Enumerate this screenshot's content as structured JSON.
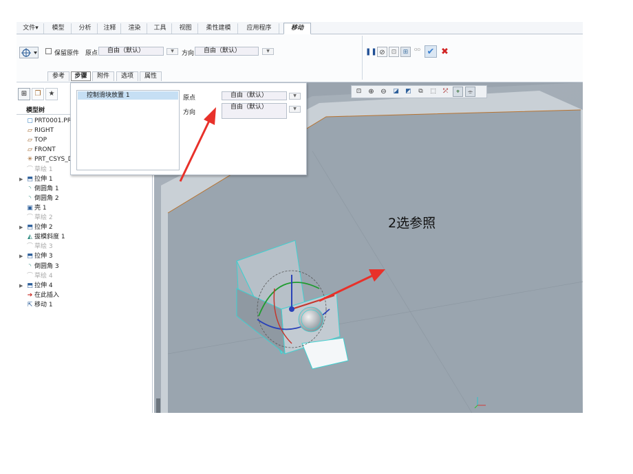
{
  "menu": {
    "tabs": [
      "文件▾",
      "模型",
      "分析",
      "注释",
      "渲染",
      "工具",
      "视图",
      "柔性建模",
      "应用程序",
      "移动"
    ]
  },
  "ribbon": {
    "keep_original_label": "保留原件",
    "origin_label": "原点",
    "origin_value": "自由（默认）",
    "direction_label": "方向",
    "direction_value": "自由（默认）",
    "subtabs": [
      "参考",
      "步骤",
      "附件",
      "选项",
      "属性"
    ]
  },
  "popup": {
    "list_item": "控制滑块放置 1",
    "origin_label": "原点",
    "origin_value": "自由（默认）",
    "direction_label": "方向",
    "direction_value": "自由（默认）"
  },
  "tree": {
    "header": "模型树",
    "items": [
      {
        "label": "PRT0001.PRT",
        "icon": "part-icon",
        "arrow": "",
        "gray": false
      },
      {
        "label": "RIGHT",
        "icon": "datum-plane-icon",
        "arrow": "",
        "gray": false
      },
      {
        "label": "TOP",
        "icon": "datum-plane-icon",
        "arrow": "",
        "gray": false
      },
      {
        "label": "FRONT",
        "icon": "datum-plane-icon",
        "arrow": "",
        "gray": false
      },
      {
        "label": "PRT_CSYS_D",
        "icon": "csys-icon",
        "arrow": "",
        "gray": false
      },
      {
        "label": "草绘 1",
        "icon": "sketch-icon",
        "arrow": "",
        "gray": true
      },
      {
        "label": "拉伸 1",
        "icon": "extrude-icon",
        "arrow": "▶",
        "gray": false
      },
      {
        "label": "倒圆角 1",
        "icon": "round-icon",
        "arrow": "",
        "gray": false
      },
      {
        "label": "倒圆角 2",
        "icon": "round-icon",
        "arrow": "",
        "gray": false
      },
      {
        "label": "壳 1",
        "icon": "shell-icon",
        "arrow": "",
        "gray": false
      },
      {
        "label": "草绘 2",
        "icon": "sketch-icon",
        "arrow": "",
        "gray": true
      },
      {
        "label": "拉伸 2",
        "icon": "extrude-icon",
        "arrow": "▶",
        "gray": false
      },
      {
        "label": "拔模斜度 1",
        "icon": "draft-icon",
        "arrow": "",
        "gray": false
      },
      {
        "label": "草绘 3",
        "icon": "sketch-icon",
        "arrow": "",
        "gray": true
      },
      {
        "label": "拉伸 3",
        "icon": "extrude-icon",
        "arrow": "▶",
        "gray": false
      },
      {
        "label": "倒圆角 3",
        "icon": "round-icon",
        "arrow": "",
        "gray": false
      },
      {
        "label": "草绘 4",
        "icon": "sketch-icon",
        "arrow": "",
        "gray": true
      },
      {
        "label": "拉伸 4",
        "icon": "extrude-icon",
        "arrow": "▶",
        "gray": false
      },
      {
        "label": "在此插入",
        "icon": "insert-here-icon",
        "arrow": "",
        "gray": false
      },
      {
        "label": "移动 1",
        "icon": "move-icon",
        "arrow": "",
        "gray": false
      }
    ]
  },
  "annotation": {
    "text": "2选参照"
  },
  "colors": {
    "arrow": "#e8312a",
    "accent_check": "#3a7fd0",
    "cancel": "#d12424",
    "box_edge": "#3fd0d0"
  }
}
